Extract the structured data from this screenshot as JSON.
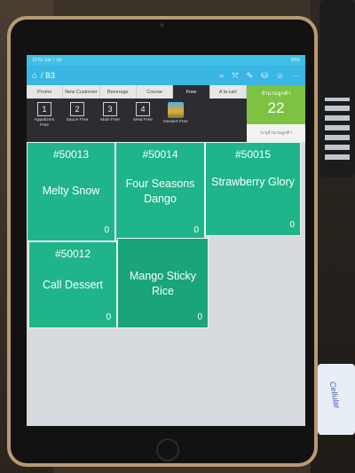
{
  "status_bar": {
    "left": "13:52 Sat 7 Jul",
    "right": "83%"
  },
  "top_bar": {
    "table": "/ B3"
  },
  "tabs": [
    {
      "label": "Promo"
    },
    {
      "label": "New Customer"
    },
    {
      "label": "Beverage"
    },
    {
      "label": "Course"
    },
    {
      "label": "Free"
    },
    {
      "label": "A la cart"
    }
  ],
  "courses": [
    {
      "num": "1",
      "label": "Appetizers Free"
    },
    {
      "num": "2",
      "label": "Sauce Free"
    },
    {
      "num": "3",
      "label": "Main Free"
    },
    {
      "num": "4",
      "label": "Meal Free"
    },
    {
      "num": "",
      "label": "Dessert Free"
    }
  ],
  "guest_panel": {
    "title": "จำนวนลูกค้า",
    "count": "22",
    "button": "ระบุจำนวนลูกค้า"
  },
  "menu_items": [
    {
      "code": "#50013",
      "name": "Melty Snow",
      "qty": "0"
    },
    {
      "code": "#50014",
      "name": "Four Seasons Dango",
      "qty": "0"
    },
    {
      "code": "#50015",
      "name": "Strawberry Glory",
      "qty": "0"
    },
    {
      "code": "#50012",
      "name": "Call Dessert",
      "qty": "0"
    },
    {
      "code": "",
      "name": "Mango Sticky Rice",
      "qty": "0"
    }
  ],
  "colors": {
    "accent": "#39b6e3",
    "item": "#1fb48a",
    "guest": "#7dc243"
  },
  "background_items": {
    "sticker_text": "Cellular"
  }
}
